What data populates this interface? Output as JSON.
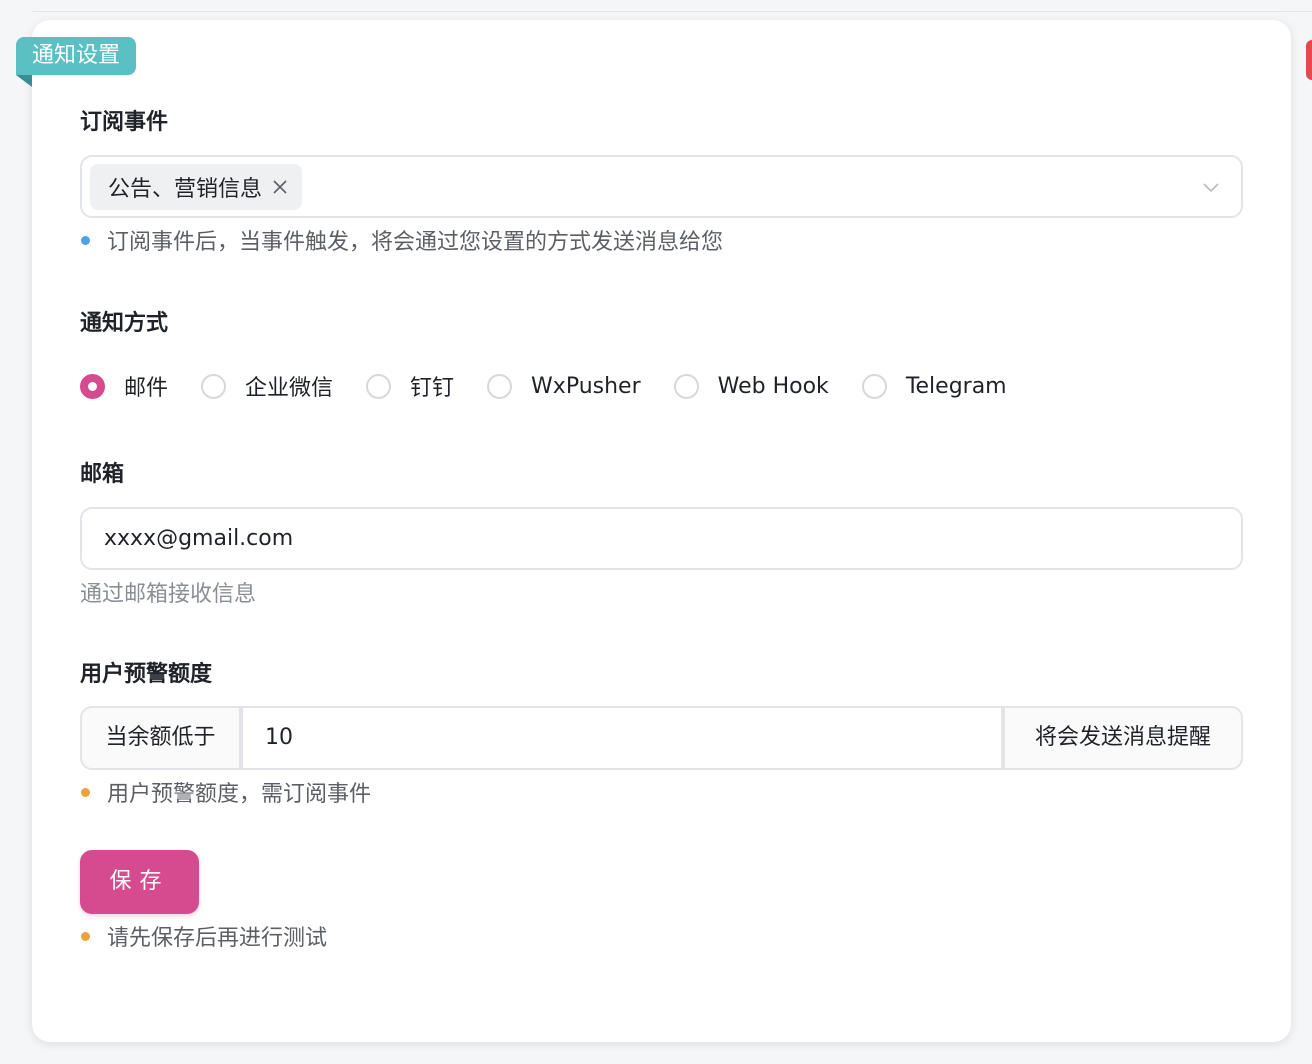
{
  "colors": {
    "accent": "#d64b8f",
    "ribbon": "#5ac0c4",
    "info_dot": "#4aa3e8",
    "warn_dot": "#f0a23a"
  },
  "ribbon": {
    "label": "通知设置"
  },
  "subscribe": {
    "label": "订阅事件",
    "selected_tag": "公告、营销信息",
    "tag_close_icon": "close-icon",
    "dropdown_icon": "chevron-down-icon",
    "hint": "订阅事件后，当事件触发，将会通过您设置的方式发送消息给您"
  },
  "notify_method": {
    "label": "通知方式",
    "selected": "邮件",
    "options": [
      "邮件",
      "企业微信",
      "钉钉",
      "WxPusher",
      "Web Hook",
      "Telegram"
    ]
  },
  "email": {
    "label": "邮箱",
    "value": "xxxx@gmail.com",
    "hint": "通过邮箱接收信息"
  },
  "quota": {
    "label": "用户预警额度",
    "prefix": "当余额低于",
    "value": "10",
    "suffix": "将会发送消息提醒",
    "hint": "用户预警额度，需订阅事件"
  },
  "save": {
    "label": "保存",
    "hint": "请先保存后再进行测试"
  }
}
